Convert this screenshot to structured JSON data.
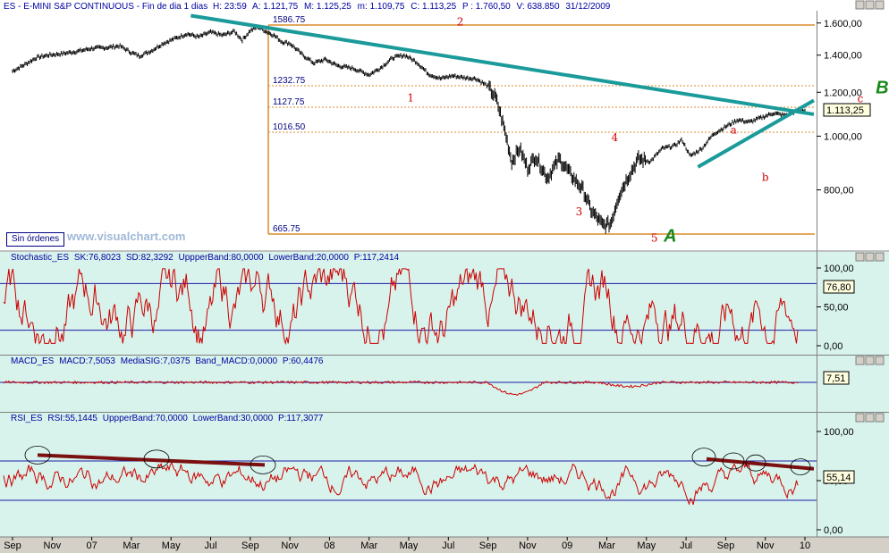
{
  "colors": {
    "price_bg": "#ffffff",
    "ind_bg": "#d8f3ec",
    "accent_trend": "#1b9a9a",
    "fib": "#d98b2b",
    "rsi_trend": "#7a1010",
    "series": "#cc0000",
    "band": "#1c1ca8"
  },
  "header": {
    "symbol": "ES - E-MINI S&P CONTINUOUS - Fin de dia 1 dias",
    "h_label": "H:",
    "h": "23:59",
    "a_label": "A:",
    "a": "1.121,75",
    "m_label": "M:",
    "m": "1.125,25",
    "mm_label": "m:",
    "mm": "1.109,75",
    "c_label": "C:",
    "c": "1.113,25",
    "p_label": "P :",
    "p": "1.760,50",
    "v_label": "V:",
    "v": "638.850",
    "date": "31/12/2009"
  },
  "buttons": {
    "orders": "Sin órdenes"
  },
  "brand": "www.visualchart.com",
  "panels": {
    "stoch": {
      "name": "Stochastic_ES",
      "sk_label": "SK:",
      "sk": "76,8023",
      "sd_label": "SD:",
      "sd": "82,3292",
      "ub_label": "UppperBand:",
      "ub": "80,0000",
      "lb_label": "LowerBand:",
      "lb": "20,0000",
      "p_label": "P:",
      "p": "117,2414",
      "current": "76,80"
    },
    "macd": {
      "name": "MACD_ES",
      "macd_label": "MACD:",
      "macd": "7,5053",
      "sig_label": "MediaSIG:",
      "sig": "7,0375",
      "band_label": "Band_MACD:",
      "band": "0,0000",
      "p_label": "P:",
      "p": "60,4476",
      "current": "7,51"
    },
    "rsi": {
      "name": "RSI_ES",
      "rsi_label": "RSI:",
      "rsi": "55,1445",
      "ub_label": "UppperBand:",
      "ub": "70,0000",
      "lb_label": "LowerBand:",
      "lb": "30,0000",
      "p_label": "P:",
      "p": "117,3077",
      "current": "55,14"
    }
  },
  "chart_data": {
    "type": "line",
    "price_axis_ticks": [
      "1.600,00",
      "1.400,00",
      "1.200,00",
      "1.000,00",
      "800,00"
    ],
    "price_tick_values": [
      1600,
      1400,
      1200,
      1000,
      800
    ],
    "current_price_label": "1.113,25",
    "current_price": 1113.25,
    "fib_levels": [
      {
        "label": "1586.75",
        "value": 1586.75
      },
      {
        "label": "1232.75",
        "value": 1232.75
      },
      {
        "label": "1127.75",
        "value": 1127.75
      },
      {
        "label": "1016.50",
        "value": 1016.5
      },
      {
        "label": "665.75",
        "value": 665.75
      }
    ],
    "x_labels": [
      "Sep",
      "Nov",
      "07",
      "Mar",
      "May",
      "Jul",
      "Sep",
      "Nov",
      "08",
      "Mar",
      "May",
      "Jul",
      "Sep",
      "Nov",
      "09",
      "Mar",
      "May",
      "Jul",
      "Sep",
      "Nov",
      "10"
    ],
    "x_label_pos": [
      0,
      1,
      2,
      3,
      4,
      5,
      6,
      7,
      8,
      9,
      10,
      11,
      12,
      13,
      14,
      15,
      16,
      17,
      18,
      19,
      20
    ],
    "price_series": {
      "t": [
        0,
        0.3,
        0.6,
        0.9,
        1.3,
        1.7,
        2,
        2.4,
        2.7,
        3,
        3.2,
        3.5,
        3.8,
        4.1,
        4.4,
        4.7,
        5,
        5.3,
        5.6,
        5.8,
        6,
        6.2,
        6.4,
        6.6,
        6.8,
        7,
        7.3,
        7.6,
        7.9,
        8.2,
        8.6,
        9,
        9.3,
        9.6,
        9.9,
        10.2,
        10.5,
        10.8,
        11.1,
        11.4,
        11.7,
        12,
        12.2,
        12.4,
        12.6,
        12.8,
        13,
        13.2,
        13.5,
        13.8,
        14.1,
        14.4,
        14.6,
        14.9,
        15.1,
        15.3,
        15.5,
        15.8,
        16.1,
        16.4,
        16.7,
        16.9,
        17.1,
        17.4,
        17.7,
        18,
        18.3,
        18.6,
        18.9,
        19.2,
        19.5,
        19.8,
        20
      ],
      "v": [
        1310,
        1345,
        1385,
        1400,
        1410,
        1425,
        1440,
        1445,
        1455,
        1415,
        1395,
        1425,
        1470,
        1500,
        1530,
        1510,
        1540,
        1520,
        1545,
        1490,
        1550,
        1575,
        1545,
        1520,
        1480,
        1470,
        1405,
        1355,
        1375,
        1340,
        1325,
        1290,
        1330,
        1385,
        1400,
        1360,
        1295,
        1270,
        1285,
        1275,
        1270,
        1230,
        1170,
        1040,
        900,
        950,
        875,
        920,
        840,
        910,
        850,
        800,
        735,
        690,
        695,
        780,
        835,
        910,
        900,
        950,
        960,
        985,
        920,
        950,
        1010,
        1040,
        1070,
        1060,
        1080,
        1100,
        1090,
        1110,
        1113
      ]
    },
    "stoch": {
      "ylim": [
        0,
        100
      ],
      "ticks": [
        "100,00",
        "50,00",
        "0,00"
      ],
      "tick_values": [
        100,
        50,
        0
      ],
      "upper": 80,
      "lower": 20
    },
    "macd": {
      "ylim": [
        -60,
        40
      ],
      "zero": 0
    },
    "rsi": {
      "ylim": [
        0,
        100
      ],
      "ticks": [
        "100,00",
        "50,00",
        "0,00"
      ],
      "tick_values": [
        100,
        50,
        0
      ],
      "upper": 70,
      "lower": 30
    },
    "wave_labels": [
      {
        "label": "1",
        "t": 10.05,
        "v": 1155
      },
      {
        "label": "2",
        "t": 11.3,
        "v": 1585
      },
      {
        "label": "3",
        "t": 14.3,
        "v": 720
      },
      {
        "label": "4",
        "t": 15.2,
        "v": 980
      },
      {
        "label": "5",
        "t": 16.2,
        "v": 645
      },
      {
        "label": "a",
        "t": 18.2,
        "v": 1010
      },
      {
        "label": "b",
        "t": 19.0,
        "v": 830
      },
      {
        "label": "c",
        "t": 21.4,
        "v": 1150
      }
    ],
    "big_labels": [
      {
        "label": "A",
        "t": 16.6,
        "v": 645
      },
      {
        "label": "B",
        "t": 21.95,
        "v": 1195
      }
    ]
  }
}
